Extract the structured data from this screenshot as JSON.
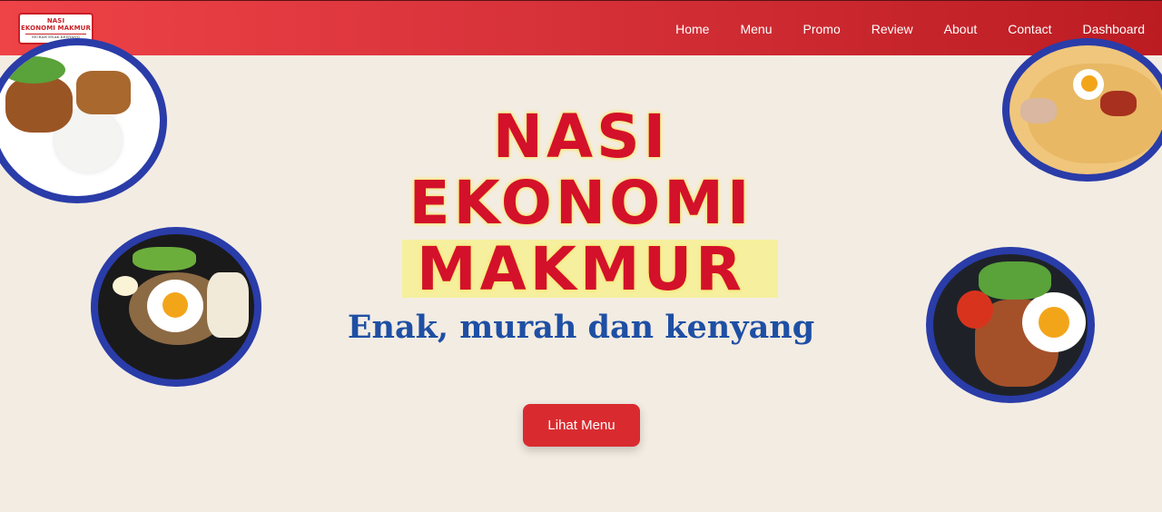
{
  "brand": {
    "line1": "NASI",
    "line2": "EKONOMI MAKMUR",
    "tagline": "MURAH ENAK KENYANG"
  },
  "nav": {
    "items": [
      "Home",
      "Menu",
      "Promo",
      "Review",
      "About",
      "Contact",
      "Dashboard"
    ]
  },
  "hero": {
    "title_line1": "NASI",
    "title_line2": "EKONOMI",
    "title_line3": "MAKMUR",
    "subtitle": "Enak, murah dan kenyang",
    "cta_label": "Lihat Menu"
  },
  "colors": {
    "navbar": "#d8323a",
    "title": "#d3112a",
    "highlight": "#f6ef9e",
    "subtitle": "#1e4fa4",
    "cta": "#d92b2f",
    "plate_rim": "#2a3ca8",
    "background": "#f3ece3"
  }
}
